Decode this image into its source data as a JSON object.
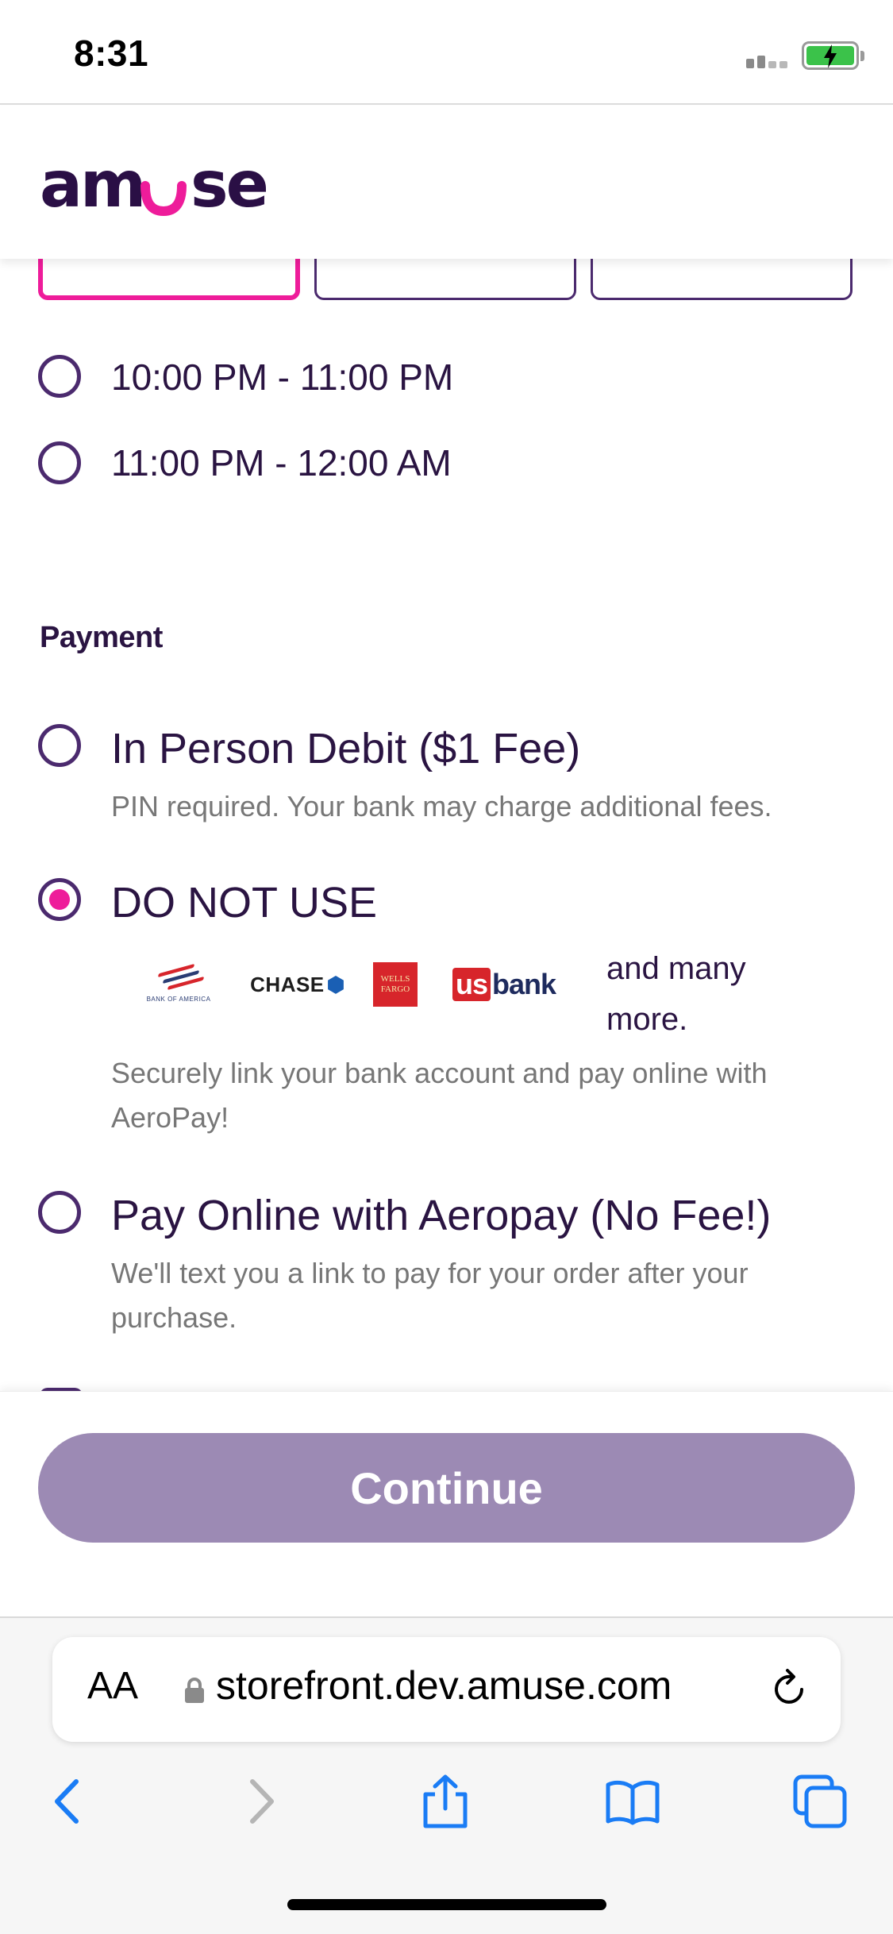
{
  "status_bar": {
    "time": "8:31"
  },
  "header": {
    "logo_text": "amuse"
  },
  "time_slots": [
    {
      "label": "10:00 PM - 11:00 PM",
      "selected": false
    },
    {
      "label": "11:00 PM - 12:00 AM",
      "selected": false
    }
  ],
  "payment": {
    "title": "Payment",
    "options": [
      {
        "label": "In Person Debit ($1 Fee)",
        "description": "PIN required. Your bank may charge additional fees.",
        "selected": false
      },
      {
        "label": "DO NOT USE",
        "description_line1": "Securely link your bank account and pay online with",
        "description_line2": "AeroPay!",
        "selected": true
      },
      {
        "label": "Pay Online with Aeropay (No Fee!)",
        "description_line1": "We'll text you a link to pay for your order after your",
        "description_line2": "purchase.",
        "selected": false
      }
    ],
    "banks": {
      "bofa_text": "BANK OF AMERICA",
      "chase_text": "CHASE",
      "wells_line1": "WELLS",
      "wells_line2": "FARGO",
      "usbank_us": "us",
      "usbank_bank": "bank",
      "more_line1": "and many",
      "more_line2": "more."
    }
  },
  "continue_button": {
    "label": "Continue"
  },
  "browser": {
    "aa_label": "AA",
    "url": "storefront.dev.amuse.com"
  },
  "colors": {
    "primary": "#2a1442",
    "accent": "#ee1c9a",
    "button_disabled": "#9c8ab4",
    "safari_blue": "#1a7cf5"
  },
  "icons": {
    "battery": "battery-charging-icon",
    "signal": "signal-icon",
    "lock": "lock-icon",
    "reload": "reload-icon",
    "back": "chevron-left-icon",
    "forward": "chevron-right-icon",
    "share": "share-icon",
    "bookmarks": "book-icon",
    "tabs": "tabs-icon"
  }
}
